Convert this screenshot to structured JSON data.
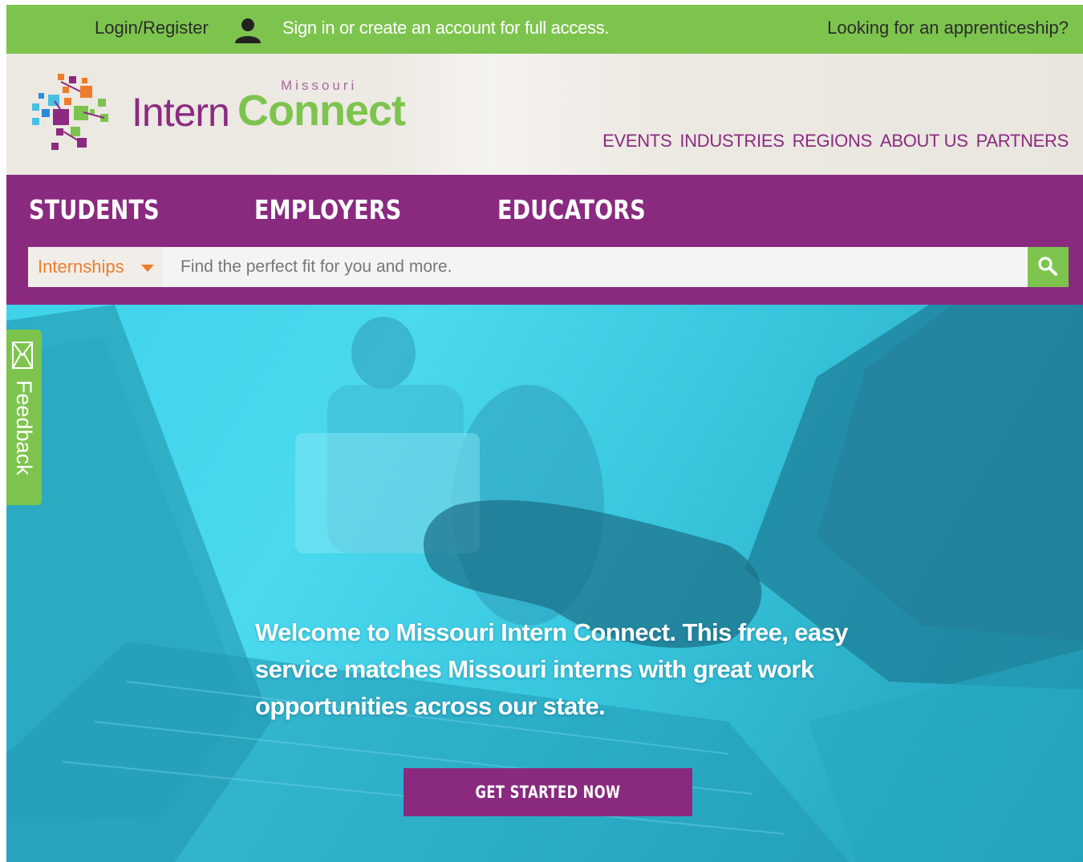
{
  "topbar": {
    "login_label": "Login/Register",
    "user_icon": "user-icon",
    "signin_text": "Sign in or create an account for full access.",
    "apprenticeship_link": "Looking for an apprenticeship?"
  },
  "header": {
    "logo": {
      "intern": "Intern",
      "connect": "Connect",
      "state": "Missouri"
    },
    "nav": [
      "EVENTS",
      "INDUSTRIES",
      "REGIONS",
      "ABOUT US",
      "PARTNERS"
    ]
  },
  "audience_nav": {
    "students": "STUDENTS",
    "employers": "EMPLOYERS",
    "educators": "EDUCATORS"
  },
  "search": {
    "type_selected": "Internships",
    "placeholder": "Find the perfect fit for you and more.",
    "button_icon": "search-icon"
  },
  "hero": {
    "message": "Welcome to Missouri Intern Connect. This free, easy service matches Missouri interns with great work opportunities across our state.",
    "cta_label": "GET STARTED NOW"
  },
  "feedback": {
    "label": "Feedback",
    "icon": "envelope-icon"
  },
  "colors": {
    "green": "#7dc44e",
    "purple": "#892a7f",
    "orange": "#ee7d2b",
    "hero_cyan": "#3ed3ea"
  }
}
